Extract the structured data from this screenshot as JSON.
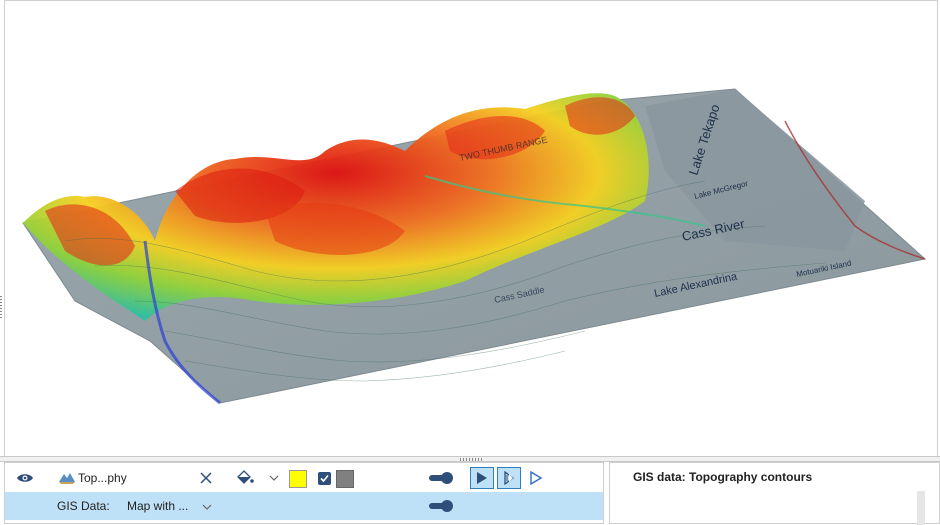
{
  "viewer": {
    "map_labels": {
      "lake_tekapo": "Lake Tekapo",
      "cass_river": "Cass River",
      "lake_alexandrina": "Lake Alexandrina",
      "motuariki_island": "Motuariki Island",
      "lake_mcgregor": "Lake McGregor",
      "two_thumb_range": "TWO THUMB RANGE",
      "cass_saddle": "Cass Saddle"
    }
  },
  "layers": {
    "row1": {
      "name": "Top...phy",
      "icons": [
        "eye-icon",
        "topography-icon",
        "close-icon",
        "paint-bucket-icon",
        "chevron-down-icon",
        "checkbox-icon",
        "toggle-icon",
        "play-icon",
        "lighting-icon",
        "play-outline-icon"
      ],
      "swatch_color": "#ffff00",
      "edge_color": "#808080",
      "checkbox_checked": true
    },
    "row2": {
      "label": "GIS Data:",
      "value": "Map with ...",
      "icons": [
        "chevron-down-icon",
        "toggle-icon"
      ],
      "highlight_color": "#bfe1f7"
    }
  },
  "properties": {
    "title": "GIS data: Topography contours"
  }
}
